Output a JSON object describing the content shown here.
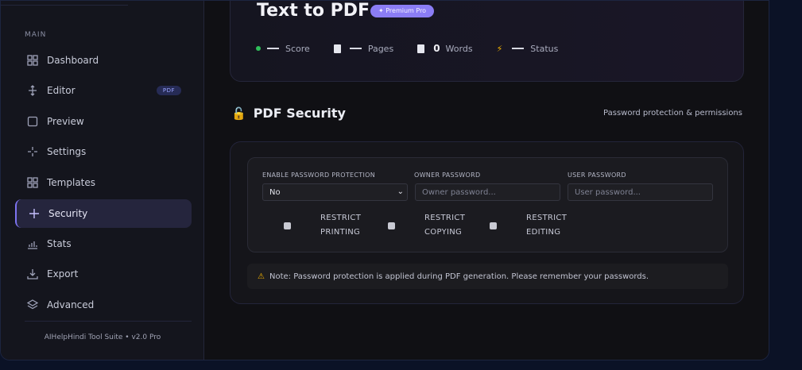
{
  "sidebar": {
    "section": "MAIN",
    "items": [
      {
        "label": "Dashboard",
        "icon": "grid-icon",
        "active": false
      },
      {
        "label": "Editor",
        "icon": "move-icon",
        "badge": "PDF",
        "active": false
      },
      {
        "label": "Preview",
        "icon": "square-icon",
        "active": false
      },
      {
        "label": "Settings",
        "icon": "sparkle-icon",
        "active": false
      },
      {
        "label": "Templates",
        "icon": "grid-icon",
        "active": false
      },
      {
        "label": "Security",
        "icon": "plus-icon",
        "active": true
      },
      {
        "label": "Stats",
        "icon": "bar-chart-icon",
        "active": false
      },
      {
        "label": "Export",
        "icon": "download-icon",
        "active": false
      },
      {
        "label": "Advanced",
        "icon": "layers-icon",
        "active": false
      }
    ],
    "footer": "AIHelpHindi Tool Suite • v2.0 Pro"
  },
  "header": {
    "title": "Text to PDF",
    "premium_badge": "✦ Premium Pro",
    "stats": {
      "score_label": "Score",
      "pages_label": "Pages",
      "words_value": "0",
      "words_label": "Words",
      "status_label": "Status"
    }
  },
  "security": {
    "title": "PDF Security",
    "subtitle": "Password protection & permissions",
    "enable_label": "ENABLE PASSWORD PROTECTION",
    "enable_value": "No",
    "owner_label": "OWNER PASSWORD",
    "owner_placeholder": "Owner password...",
    "user_label": "USER PASSWORD",
    "user_placeholder": "User password...",
    "restrictions": [
      {
        "line1": "RESTRICT",
        "line2": "PRINTING",
        "checked": false
      },
      {
        "line1": "RESTRICT",
        "line2": "COPYING",
        "checked": false
      },
      {
        "line1": "RESTRICT",
        "line2": "EDITING",
        "checked": false
      }
    ],
    "note": "Note: Password protection is applied during PDF generation. Please remember your passwords."
  },
  "colors": {
    "accent": "#7d73f0",
    "premium": "#8b7df5",
    "warning": "#f5b400",
    "status_dot": "#2fbf5a"
  }
}
